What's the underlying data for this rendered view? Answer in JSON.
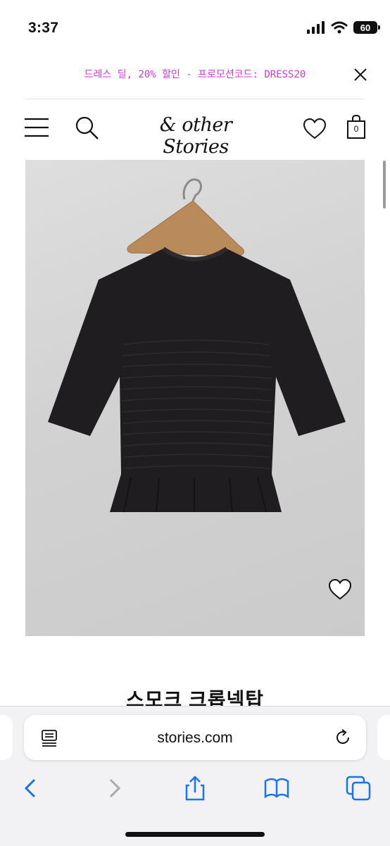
{
  "status_bar": {
    "time": "3:37",
    "battery": "60"
  },
  "promo": {
    "text": "드레스 딜, 20% 할인 - 프로모션코드: DRESS20"
  },
  "header": {
    "brand": "& other Stories",
    "bag_count": "0"
  },
  "product": {
    "title": "스모크 크롭넥탑"
  },
  "browser": {
    "url": "stories.com"
  },
  "colors": {
    "promo": "#d23ad9",
    "accent": "#1a73e8"
  },
  "icons": [
    "menu-icon",
    "search-icon",
    "heart-icon",
    "bag-icon",
    "close-icon",
    "reader-icon",
    "reload-icon",
    "back-icon",
    "forward-icon",
    "share-icon",
    "bookmarks-icon",
    "tabs-icon"
  ]
}
